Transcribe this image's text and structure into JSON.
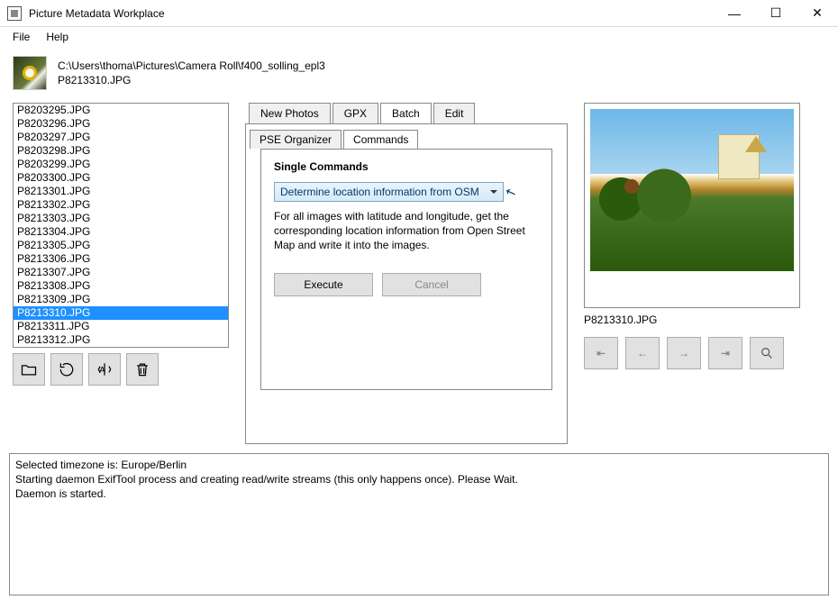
{
  "window": {
    "title": "Picture Metadata Workplace"
  },
  "menu": {
    "file": "File",
    "help": "Help"
  },
  "path": {
    "folder": "C:\\Users\\thoma\\Pictures\\Camera Roll\\f400_solling_epl3",
    "file": "P8213310.JPG"
  },
  "filelist": {
    "items": [
      "P8203295.JPG",
      "P8203296.JPG",
      "P8203297.JPG",
      "P8203298.JPG",
      "P8203299.JPG",
      "P8203300.JPG",
      "P8213301.JPG",
      "P8213302.JPG",
      "P8213303.JPG",
      "P8213304.JPG",
      "P8213305.JPG",
      "P8213306.JPG",
      "P8213307.JPG",
      "P8213308.JPG",
      "P8213309.JPG",
      "P8213310.JPG",
      "P8213311.JPG",
      "P8213312.JPG"
    ],
    "selected_index": 15
  },
  "tabs": {
    "main": [
      "New Photos",
      "GPX",
      "Batch",
      "Edit"
    ],
    "main_active": 2,
    "sub": [
      "PSE Organizer",
      "Commands"
    ],
    "sub_active": 1
  },
  "batch": {
    "group_title": "Single Commands",
    "dropdown_value": "Determine location information from OSM",
    "description": "For all images with latitude and longitude, get the corresponding location information from Open Street Map and write it into the images.",
    "execute": "Execute",
    "cancel": "Cancel"
  },
  "preview": {
    "caption": "P8213310.JPG"
  },
  "nav": {
    "first": "⇤",
    "prev": "←",
    "next": "→",
    "last": "⇥"
  },
  "log": {
    "l1": "Selected timezone is: Europe/Berlin",
    "l2": "Starting daemon ExifTool process and creating read/write streams (this only happens once). Please Wait.",
    "l3": "Daemon is started."
  }
}
